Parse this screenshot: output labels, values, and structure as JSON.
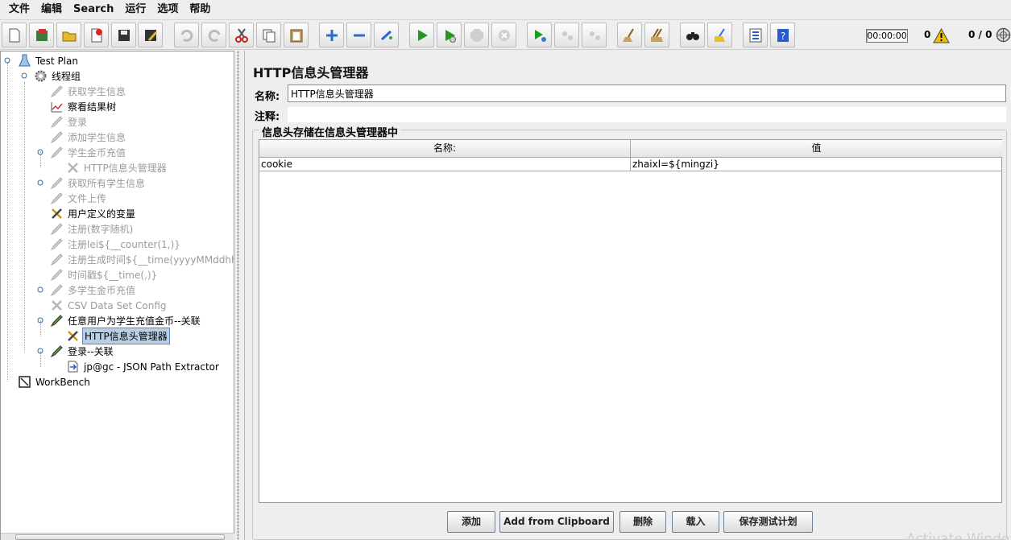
{
  "menubar": {
    "items": [
      "文件",
      "编辑",
      "Search",
      "运行",
      "选项",
      "帮助"
    ]
  },
  "toolbar": {
    "timer": "00:00:00",
    "warning_count": "0",
    "thread_count": "0 / 0"
  },
  "tree": {
    "nodes": [
      {
        "label": "Test Plan",
        "icon": "test-plan-icon",
        "enabled": true
      },
      {
        "label": "线程组",
        "icon": "thread-group-gear-icon",
        "enabled": true
      },
      {
        "label": "获取学生信息",
        "icon": "http-sampler-pencil-icon",
        "enabled": false
      },
      {
        "label": "察看结果树",
        "icon": "results-tree-chart-icon",
        "enabled": true
      },
      {
        "label": "登录",
        "icon": "http-sampler-pencil-icon",
        "enabled": false
      },
      {
        "label": "添加学生信息",
        "icon": "http-sampler-pencil-icon",
        "enabled": false
      },
      {
        "label": "学生金币充值",
        "icon": "http-sampler-pencil-icon",
        "enabled": false
      },
      {
        "label": "HTTP信息头管理器",
        "icon": "config-tools-icon",
        "enabled": false
      },
      {
        "label": "获取所有学生信息",
        "icon": "http-sampler-pencil-icon",
        "enabled": false
      },
      {
        "label": "文件上传",
        "icon": "http-sampler-pencil-icon",
        "enabled": false
      },
      {
        "label": "用户定义的变量",
        "icon": "config-tools-icon",
        "enabled": true
      },
      {
        "label": "注册(数字随机)",
        "icon": "http-sampler-pencil-icon",
        "enabled": false
      },
      {
        "label": "注册lei${__counter(1,)}",
        "icon": "http-sampler-pencil-icon",
        "enabled": false
      },
      {
        "label": "注册生成时间${__time(yyyyMMddhhmm",
        "icon": "http-sampler-pencil-icon",
        "enabled": false
      },
      {
        "label": "时间戳${__time(,)}",
        "icon": "http-sampler-pencil-icon",
        "enabled": false
      },
      {
        "label": "多学生金币充值",
        "icon": "http-sampler-pencil-icon",
        "enabled": false
      },
      {
        "label": "CSV Data Set Config",
        "icon": "config-tools-icon",
        "enabled": false
      },
      {
        "label": "任意用户为学生充值金币--关联",
        "icon": "http-sampler-pencil-icon",
        "enabled": true
      },
      {
        "label": "HTTP信息头管理器",
        "icon": "config-tools-icon",
        "enabled": true,
        "selected": true
      },
      {
        "label": "登录--关联",
        "icon": "http-sampler-pencil-icon",
        "enabled": true
      },
      {
        "label": "jp@gc - JSON Path Extractor",
        "icon": "post-processor-arrow-icon",
        "enabled": true
      },
      {
        "label": "WorkBench",
        "icon": "workbench-icon",
        "enabled": true
      }
    ]
  },
  "panel": {
    "title": "HTTP信息头管理器",
    "name_label": "名称:",
    "name_value": "HTTP信息头管理器",
    "comment_label": "注释:",
    "comment_value": "",
    "group_title": "信息头存储在信息头管理器中"
  },
  "table": {
    "headers": [
      "名称:",
      "值"
    ],
    "rows": [
      [
        "cookie",
        "zhaixl=${mingzi}"
      ]
    ]
  },
  "buttons": {
    "add": "添加",
    "add_clipboard": "Add from Clipboard",
    "delete": "删除",
    "load": "载入",
    "save_plan": "保存测试计划"
  },
  "watermark": "Activate Windows",
  "colors": {
    "selection_bg": "#b8cfe5",
    "selection_border": "#6382bf",
    "disabled_text": "#9b9b9b",
    "run_green": "#1e9b1e"
  }
}
